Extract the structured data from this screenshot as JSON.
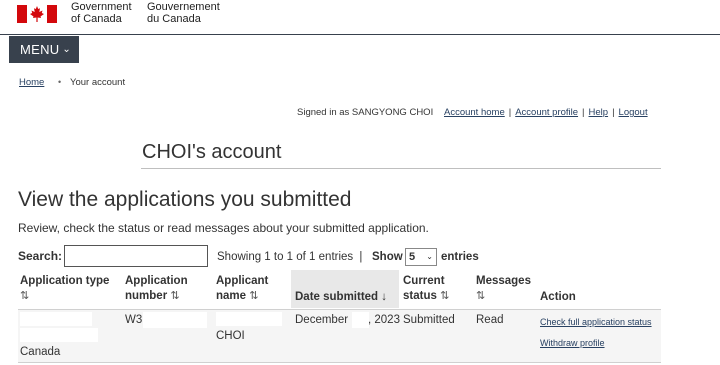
{
  "header": {
    "gov_en_line1": "Government",
    "gov_en_line2": "of Canada",
    "gov_fr_line1": "Gouvernement",
    "gov_fr_line2": "du Canada",
    "menu_label": "MENU",
    "accent_red": "#d3080c",
    "menu_bg": "#38414d"
  },
  "breadcrumb": {
    "home": "Home",
    "current": "Your account"
  },
  "account_bar": {
    "signed_in": "Signed in as SANGYONG CHOI",
    "links": [
      "Account home",
      "Account profile",
      "Help",
      "Logout"
    ]
  },
  "account_title": "CHOI's account",
  "page": {
    "heading": "View the applications you submitted",
    "description": "Review, check the status or read messages about your submitted application."
  },
  "table_controls": {
    "search_label": "Search:",
    "search_value": "",
    "showing": "Showing 1 to 1 of 1 entries",
    "show_label": "Show",
    "show_value": "5",
    "entries_label": "entries"
  },
  "table": {
    "headers": {
      "app_type_1": "Application type",
      "app_number_1": "Application",
      "app_number_2": "number",
      "applicant_1": "Applicant",
      "applicant_2": "name",
      "date": "Date submitted",
      "status_1": "Current",
      "status_2": "status",
      "messages": "Messages",
      "action": "Action"
    },
    "sort_icon": "⇅",
    "sorted_desc_icon": "↓",
    "row": {
      "app_type": "Canada",
      "app_number": "W3",
      "applicant": "CHOI",
      "date_month": "December",
      "date_year": ", 2023",
      "status": "Submitted",
      "messages": "Read",
      "action_check": "Check full application status",
      "action_withdraw": "Withdraw profile"
    }
  },
  "link_color": "#284162"
}
